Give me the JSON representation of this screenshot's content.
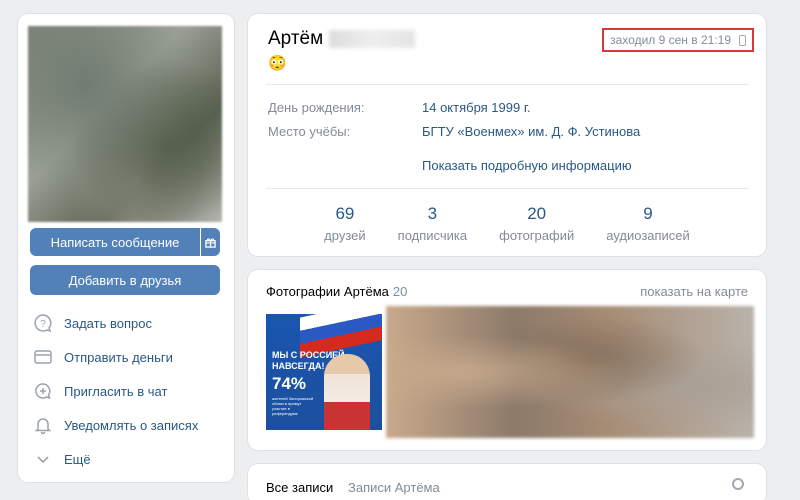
{
  "left": {
    "write_message": "Написать сообщение",
    "add_friend": "Добавить в друзья",
    "actions": [
      {
        "label": "Задать вопрос",
        "icon": "question-icon"
      },
      {
        "label": "Отправить деньги",
        "icon": "money-icon"
      },
      {
        "label": "Пригласить в чат",
        "icon": "chat-add-icon"
      },
      {
        "label": "Уведомлять о записях",
        "icon": "bell-icon"
      },
      {
        "label": "Ещё",
        "icon": "chevron-down-icon"
      }
    ]
  },
  "profile": {
    "name": "Артём",
    "emoji": "😳",
    "last_seen": "заходил 9 сен в 21:19",
    "birthday_label": "День рождения:",
    "birthday_value": "14 октября 1999 г.",
    "education_label": "Место учёбы:",
    "education_value": "БГТУ «Военмех» им. Д. Ф. Устинова",
    "more_info": "Показать подробную информацию",
    "stats": [
      {
        "num": "69",
        "label": "друзей"
      },
      {
        "num": "3",
        "label": "подписчика"
      },
      {
        "num": "20",
        "label": "фотографий"
      },
      {
        "num": "9",
        "label": "аудиозаписей"
      }
    ]
  },
  "photos": {
    "title": "Фотографии Артёма",
    "count": "20",
    "map_link": "показать на карте",
    "poster_line1": "МЫ С РОССИЕЙ",
    "poster_line2": "НАВСЕГДА!",
    "poster_percent": "74%",
    "poster_small": "жителей Запорожской области примут участие в референдуме"
  },
  "wall": {
    "tab_all": "Все записи",
    "tab_own": "Записи Артёма"
  },
  "colors": {
    "accent": "#5181b8",
    "link": "#2a5885",
    "secondary": "#818c99",
    "highlight_border": "#d63a3a",
    "background": "#edeef0"
  }
}
